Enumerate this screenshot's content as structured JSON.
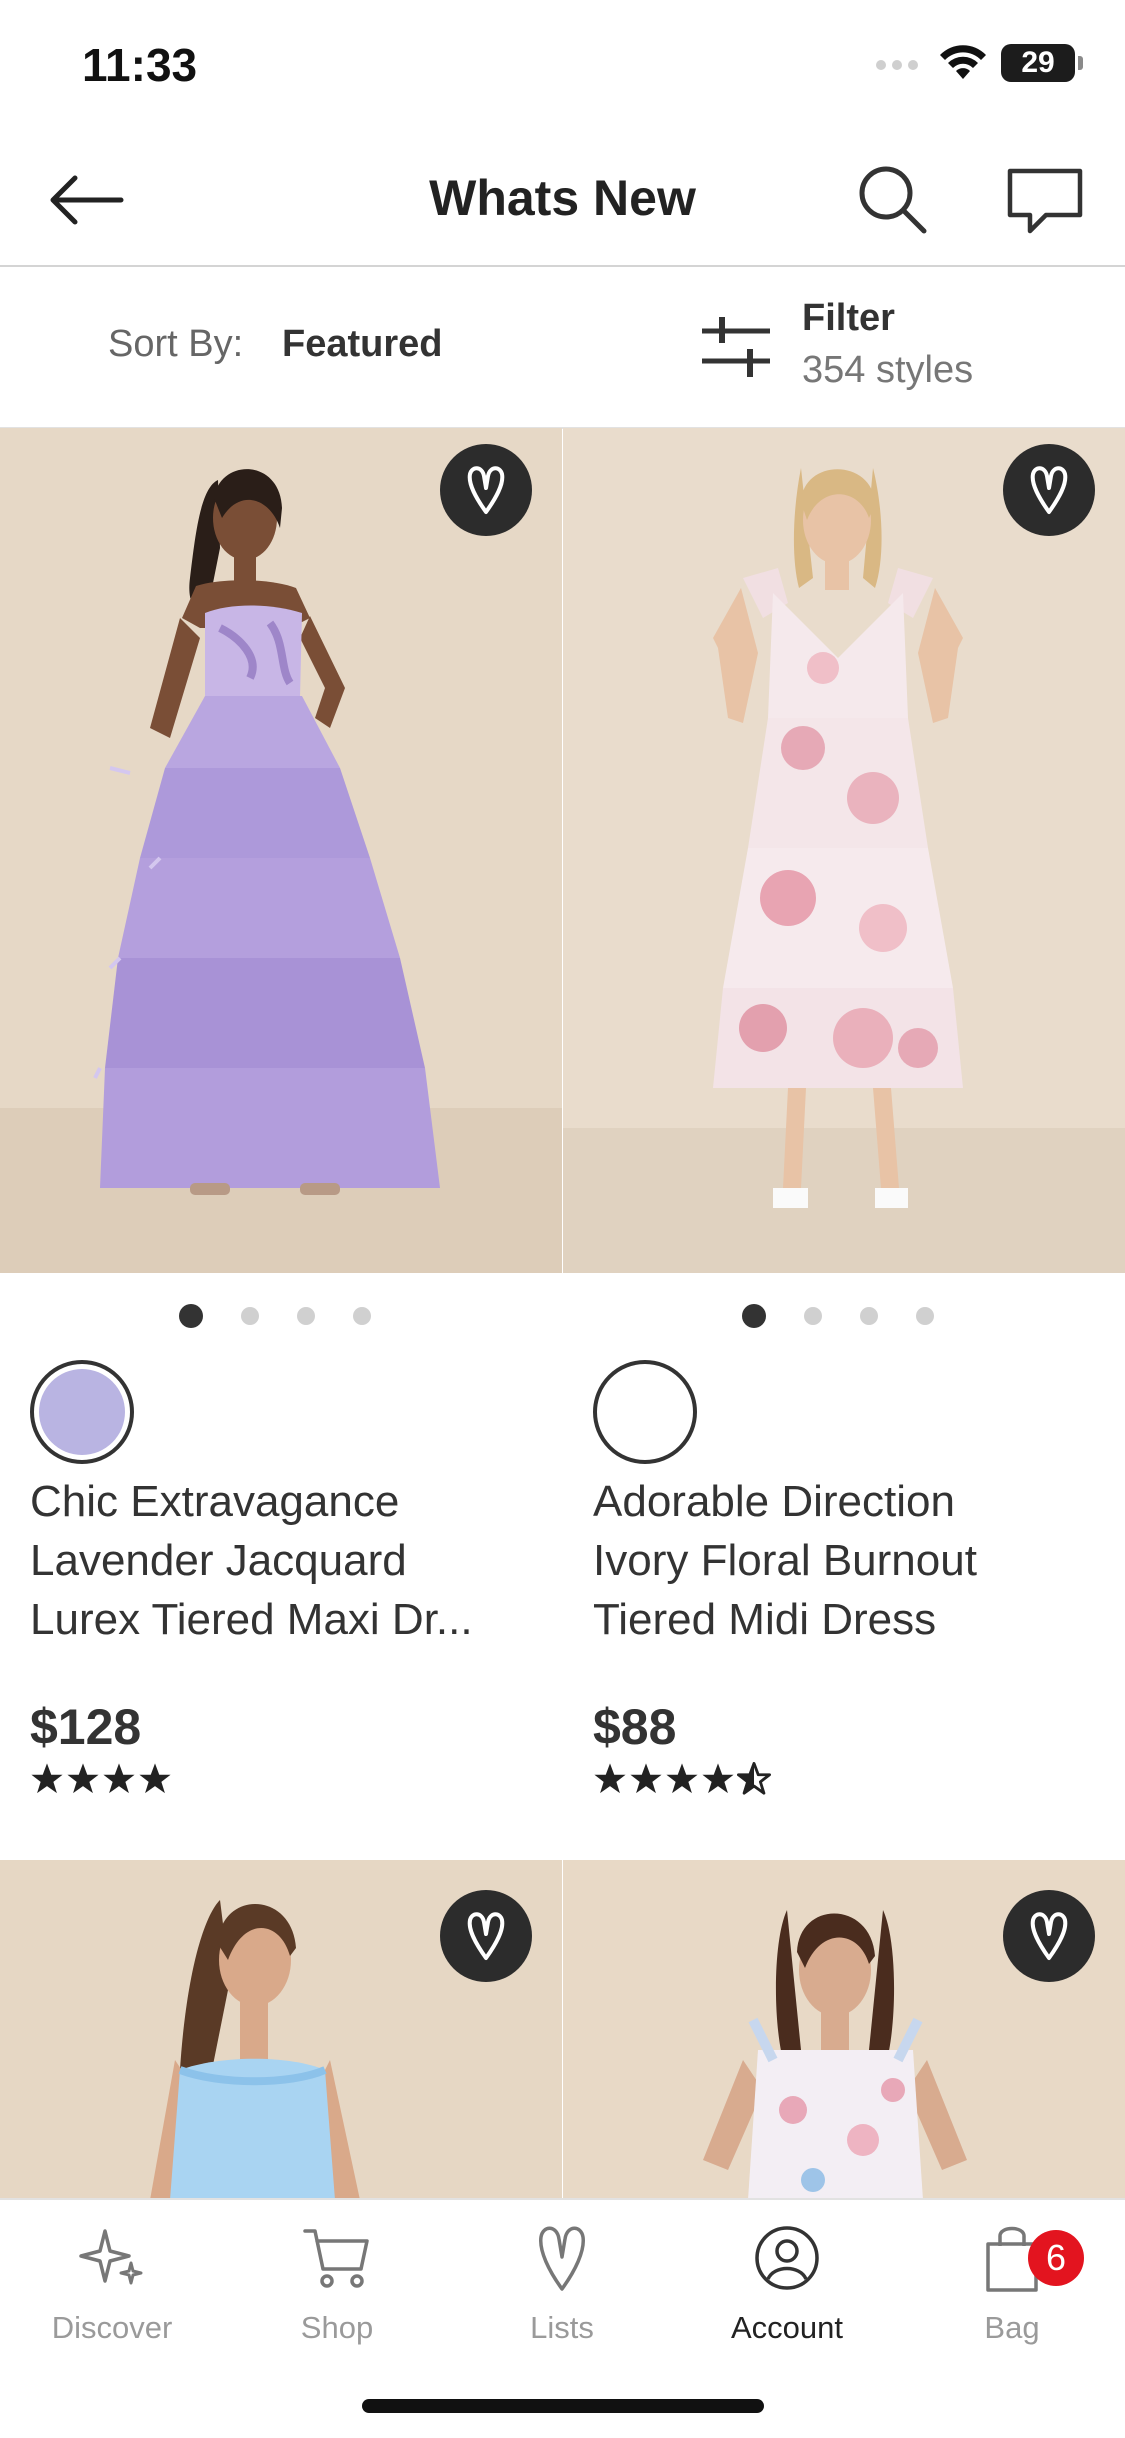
{
  "status_bar": {
    "time": "11:33",
    "battery": "29"
  },
  "header": {
    "title": "Whats New"
  },
  "toolbar": {
    "sort_label": "Sort By:",
    "sort_value": "Featured",
    "filter_label": "Filter",
    "style_count": "354 styles"
  },
  "products": [
    {
      "name_lines": [
        "Chic Extravagance",
        "Lavender Jacquard",
        "Lurex Tiered Maxi Dr..."
      ],
      "price": "$128",
      "rating": 4,
      "swatch_color": "#b9b4e2",
      "image_count": 4,
      "active_image": 1
    },
    {
      "name_lines": [
        "Adorable Direction",
        "Ivory Floral Burnout",
        "Tiered Midi Dress"
      ],
      "price": "$88",
      "rating": 4.5,
      "swatch_color": "#ffffff",
      "image_count": 4,
      "active_image": 1
    }
  ],
  "bottom_nav": {
    "items": [
      {
        "label": "Discover",
        "icon": "sparkle-icon"
      },
      {
        "label": "Shop",
        "icon": "cart-icon"
      },
      {
        "label": "Lists",
        "icon": "heart-icon"
      },
      {
        "label": "Account",
        "icon": "account-icon"
      },
      {
        "label": "Bag",
        "icon": "bag-icon"
      }
    ],
    "active": "Account",
    "bag_count": "6"
  }
}
